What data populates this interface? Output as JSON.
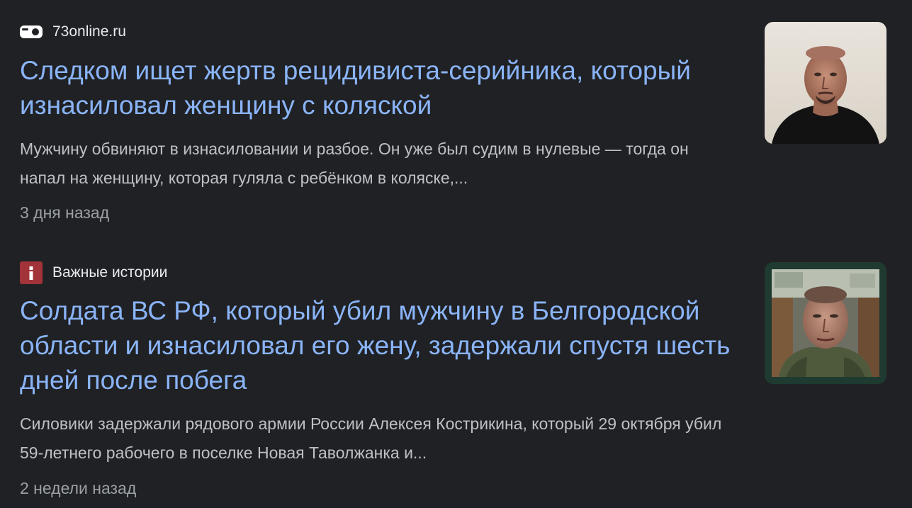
{
  "results": [
    {
      "source": {
        "name": "73online.ru",
        "icon": "toggle-logo-icon"
      },
      "headline": "Следком ищет жертв рецидивиста-серийника, который изнасиловал женщину с коляской",
      "snippet": "Мужчину обвиняют в изнасиловании и разбое. Он уже был судим в нулевые — тогда он напал на женщину, которая гуляла с ребёнком в коляске,...",
      "time": "3 дня назад",
      "thumbnail": "man-portrait-thumbnail"
    },
    {
      "source": {
        "name": "Важные истории",
        "icon": "info-i-logo-icon"
      },
      "headline": "Солдата ВС РФ, который убил мужчину в Белгородской области и изнасиловал его жену, задержали спустя шесть дней после побега",
      "snippet": "Силовики задержали рядового армии России Алексея Кострикина, который 29 октября убил 59-летнего рабочего в поселке Новая Таволжанка и...",
      "time": "2 недели назад",
      "thumbnail": "soldier-portrait-thumbnail"
    }
  ],
  "colors": {
    "background": "#202124",
    "headline": "#8ab4f8",
    "source": "#e8eaed",
    "snippet": "#bdc1c6",
    "time": "#9aa0a6",
    "info_logo": "#a23339"
  }
}
